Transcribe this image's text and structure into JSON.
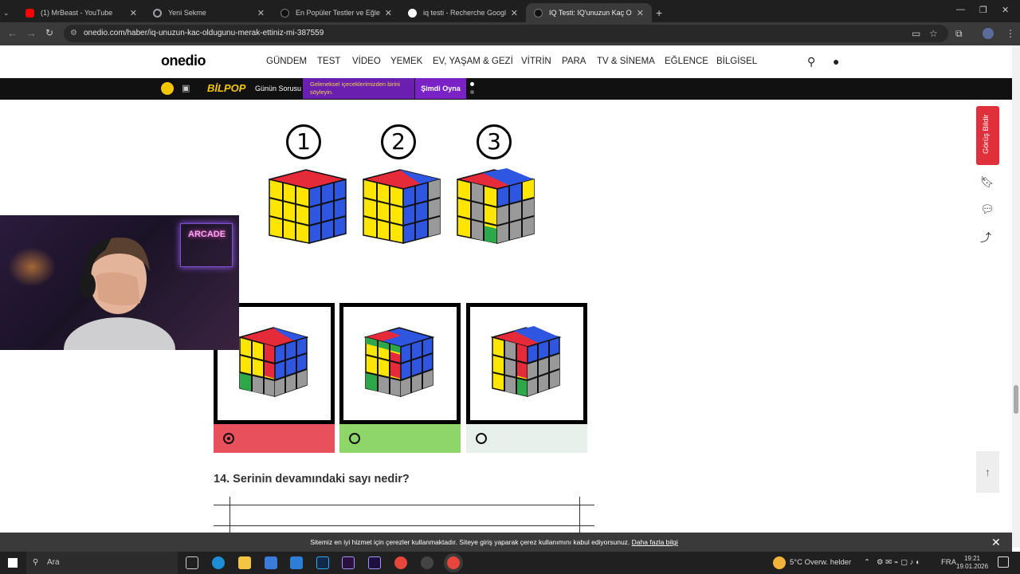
{
  "browser": {
    "tabs": [
      {
        "title": "(1) MrBeast - YouTube",
        "favicon_color": "#ff0000"
      },
      {
        "title": "Yeni Sekme",
        "favicon_color": "#9aa0a6"
      },
      {
        "title": "En Popüler Testler ve Eğlenceli",
        "favicon_color": "#111111"
      },
      {
        "title": "iq testi - Recherche Google",
        "favicon_color": "#ffffff"
      },
      {
        "title": "IQ Testi: IQ'unuzun Kaç Olduğu",
        "favicon_color": "#111111"
      }
    ],
    "url": "onedio.com/haber/iq-unuzun-kac-oldugunu-merak-ettiniz-mi-387559"
  },
  "site": {
    "logo": "onedio",
    "nav": [
      "GÜNDEM",
      "TEST",
      "VİDEO",
      "YEMEK",
      "EV, YAŞAM & GEZİ",
      "VİTRİN",
      "PARA",
      "TV & SİNEMA",
      "EĞLENCE",
      "BİLGİSEL"
    ]
  },
  "bilpop": {
    "logo": "BİLPOP",
    "label": "Günün Sorusu",
    "question": "Geleneksel içeceklerimizden birini söyleyin.",
    "cta": "Şimdi Oyna"
  },
  "question": {
    "numbers": [
      "1",
      "2",
      "3"
    ],
    "options_state": [
      "selected-wrong",
      "correct",
      "neutral"
    ],
    "option_colors": [
      "#e8505b",
      "#8fd66a",
      "#e8f0ec"
    ]
  },
  "next_question": "14. Serinin devamındaki sayı nedir?",
  "sidebar": {
    "feedback": "Görüş Bildir"
  },
  "webcam": {
    "sign": "ARCADE"
  },
  "cookie": {
    "text": "Sitemiz en iyi hizmet için çerezler kullanmaktadır. Siteye giriş yaparak çerez kullanımını kabul ediyorsunuz.",
    "link": "Daha fazla bilgi"
  },
  "taskbar": {
    "search": "Ara",
    "weather": "5°C  Overw. helder",
    "lang": "FRA",
    "time": "19:21",
    "date": "19.01.2026"
  }
}
